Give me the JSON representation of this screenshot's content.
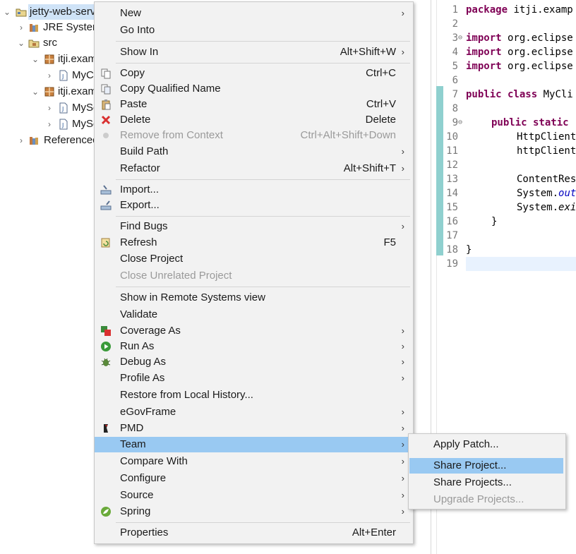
{
  "tree": {
    "project": "jetty-web-serv",
    "jre": "JRE System",
    "src": "src",
    "pkg1": "itji.exam",
    "pkg1_file": "MyC",
    "pkg2": "itji.exam",
    "pkg2_file1": "MySe",
    "pkg2_file2": "MySe",
    "referenced": "Referenced"
  },
  "editor": {
    "lines": {
      "n1": "1",
      "n2": "2",
      "n3": "3",
      "n4": "4",
      "n5": "5",
      "n6": "6",
      "n7": "7",
      "n8": "8",
      "n9": "9",
      "n10": "10",
      "n11": "11",
      "n12": "12",
      "n13": "13",
      "n14": "14",
      "n15": "15",
      "n16": "16",
      "n17": "17",
      "n18": "18",
      "n19": "19"
    },
    "code": {
      "l1_kw": "package",
      "l1_rest": " itji.examp",
      "l3_kw": "import",
      "l3_rest": " org.eclipse",
      "l4_kw": "import",
      "l4_rest": " org.eclipse",
      "l5_kw": "import",
      "l5_rest": " org.eclipse",
      "l7_kw": "public class",
      "l7_rest": " MyCli",
      "l9_kw": "public static",
      "l10": "HttpClient",
      "l11": "httpClient",
      "l13": "ContentRes",
      "l14_a": "System.",
      "l14_b": "out",
      "l15_a": "System.",
      "l15_b": "exi",
      "l16": "}",
      "l18": "}"
    }
  },
  "menu": {
    "new": "New",
    "go_into": "Go Into",
    "show_in": "Show In",
    "show_in_key": "Alt+Shift+W",
    "copy": "Copy",
    "copy_key": "Ctrl+C",
    "copy_qualified": "Copy Qualified Name",
    "paste": "Paste",
    "paste_key": "Ctrl+V",
    "delete": "Delete",
    "delete_key": "Delete",
    "remove_ctx": "Remove from Context",
    "remove_ctx_key": "Ctrl+Alt+Shift+Down",
    "build_path": "Build Path",
    "refactor": "Refactor",
    "refactor_key": "Alt+Shift+T",
    "import": "Import...",
    "export": "Export...",
    "find_bugs": "Find Bugs",
    "refresh": "Refresh",
    "refresh_key": "F5",
    "close_project": "Close Project",
    "close_unrelated": "Close Unrelated Project",
    "show_remote": "Show in Remote Systems view",
    "validate": "Validate",
    "coverage_as": "Coverage As",
    "run_as": "Run As",
    "debug_as": "Debug As",
    "profile_as": "Profile As",
    "restore_history": "Restore from Local History...",
    "egovframe": "eGovFrame",
    "pmd": "PMD",
    "team": "Team",
    "compare_with": "Compare With",
    "configure": "Configure",
    "source": "Source",
    "spring": "Spring",
    "properties": "Properties",
    "properties_key": "Alt+Enter",
    "arrow": "›"
  },
  "submenu": {
    "apply_patch": "Apply Patch...",
    "share_project": "Share Project...",
    "share_projects": "Share Projects...",
    "upgrade_projects": "Upgrade Projects..."
  }
}
